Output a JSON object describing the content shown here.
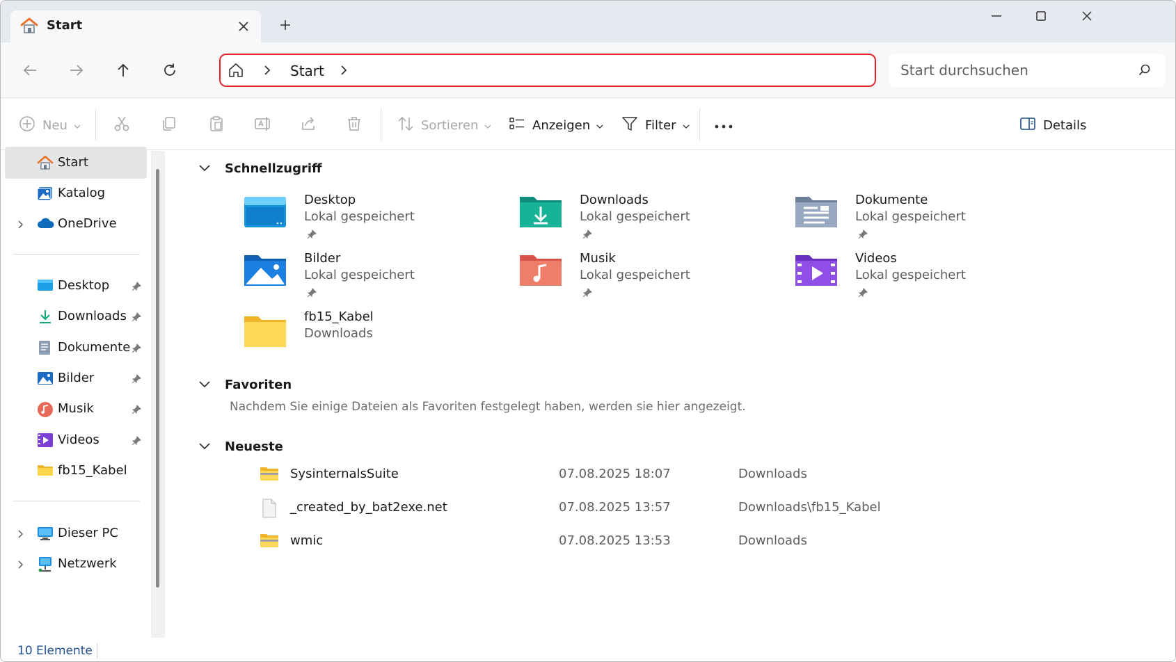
{
  "tab": {
    "title": "Start",
    "home_icon": "home-icon"
  },
  "address": {
    "crumb": "Start"
  },
  "search": {
    "placeholder": "Start durchsuchen"
  },
  "commands": {
    "new": "Neu",
    "sort": "Sortieren",
    "view": "Anzeigen",
    "filter": "Filter",
    "details": "Details"
  },
  "sidebar": {
    "items": [
      {
        "label": "Start",
        "icon": "home-icon",
        "selected": true
      },
      {
        "label": "Katalog",
        "icon": "gallery-icon"
      },
      {
        "label": "OneDrive",
        "icon": "onedrive-icon",
        "expandable": true
      }
    ],
    "pinned": [
      {
        "label": "Desktop",
        "icon": "desktop-folder-icon"
      },
      {
        "label": "Downloads",
        "icon": "download-icon"
      },
      {
        "label": "Dokumente",
        "icon": "documents-icon"
      },
      {
        "label": "Bilder",
        "icon": "pictures-icon"
      },
      {
        "label": "Musik",
        "icon": "music-icon"
      },
      {
        "label": "Videos",
        "icon": "videos-icon"
      },
      {
        "label": "fb15_Kabel",
        "icon": "folder-icon"
      }
    ],
    "bottom": [
      {
        "label": "Dieser PC",
        "icon": "pc-icon"
      },
      {
        "label": "Netzwerk",
        "icon": "network-icon"
      }
    ]
  },
  "status": {
    "count": "10 Elemente"
  },
  "sections": {
    "quick": "Schnellzugriff",
    "favorites": "Favoriten",
    "favorites_empty": "Nachdem Sie einige Dateien als Favoriten festgelegt haben, werden sie hier angezeigt.",
    "recent": "Neueste"
  },
  "quick_access": [
    {
      "name": "Desktop",
      "sub": "Lokal gespeichert"
    },
    {
      "name": "Downloads",
      "sub": "Lokal gespeichert"
    },
    {
      "name": "Dokumente",
      "sub": "Lokal gespeichert"
    },
    {
      "name": "Bilder",
      "sub": "Lokal gespeichert"
    },
    {
      "name": "Musik",
      "sub": "Lokal gespeichert"
    },
    {
      "name": "Videos",
      "sub": "Lokal gespeichert"
    },
    {
      "name": "fb15_Kabel",
      "sub": "Downloads"
    }
  ],
  "recent": [
    {
      "name": "SysinternalsSuite",
      "date": "07.08.2025 18:07",
      "location": "Downloads",
      "icon": "zip-folder-icon"
    },
    {
      "name": "_created_by_bat2exe.net",
      "date": "07.08.2025 13:57",
      "location": "Downloads\\fb15_Kabel",
      "icon": "file-icon"
    },
    {
      "name": "wmic",
      "date": "07.08.2025 13:53",
      "location": "Downloads",
      "icon": "zip-folder-icon"
    }
  ],
  "colors": {
    "address_border": "#e0262a",
    "status_text": "#1f4e8c",
    "selection": "#e5e5e5"
  }
}
